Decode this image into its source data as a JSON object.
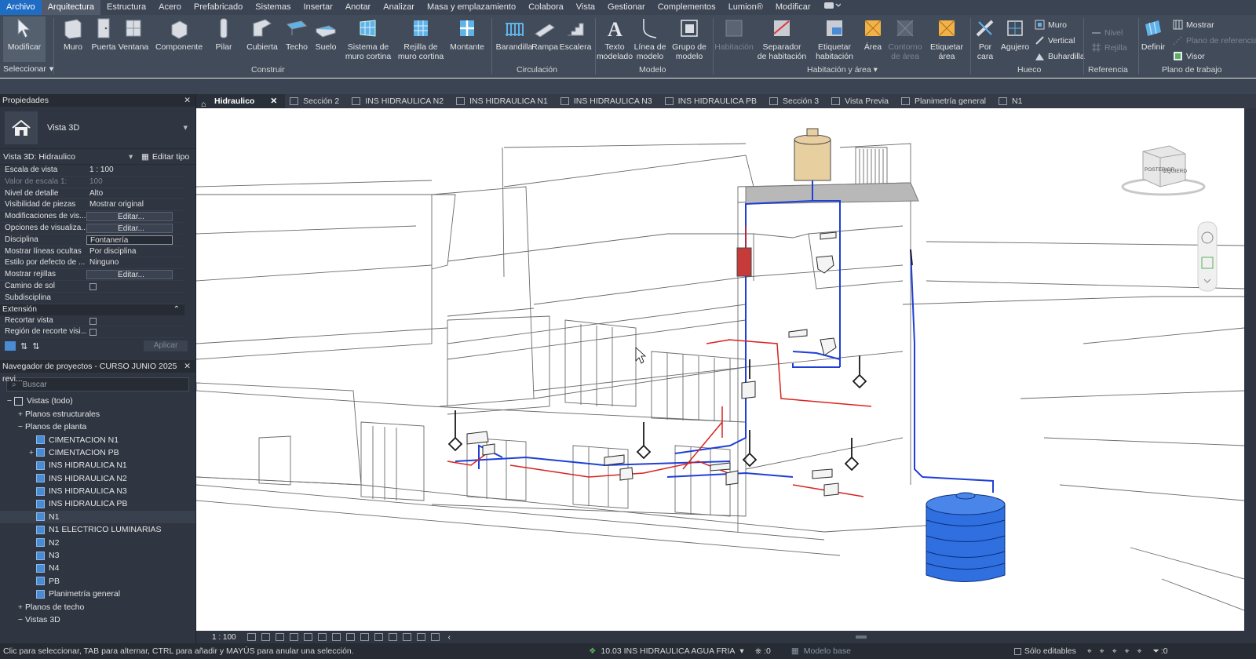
{
  "menu": {
    "items": [
      "Archivo",
      "Arquitectura",
      "Estructura",
      "Acero",
      "Prefabricado",
      "Sistemas",
      "Insertar",
      "Anotar",
      "Analizar",
      "Masa y emplazamiento",
      "Colabora",
      "Vista",
      "Gestionar",
      "Complementos",
      "Lumion®",
      "Modificar"
    ],
    "active": "Arquitectura"
  },
  "ribbon": {
    "modificar": "Modificar",
    "seleccionar": "Seleccionar",
    "construir": {
      "title": "Construir",
      "buttons": [
        "Muro",
        "Puerta",
        "Ventana",
        "Componente",
        "Pilar",
        "Cubierta",
        "Techo",
        "Suelo",
        "Sistema de\nmuro cortina",
        "Rejilla de\nmuro cortina",
        "Montante"
      ]
    },
    "circulacion": {
      "title": "Circulación",
      "buttons": [
        "Barandilla",
        "Rampa",
        "Escalera"
      ]
    },
    "modelo": {
      "title": "Modelo",
      "buttons": [
        "Texto\nmodelado",
        "Línea de\nmodelo",
        "Grupo de\nmodelo"
      ]
    },
    "habitacion": {
      "title": "Habitación y área",
      "buttons": [
        "Habitación",
        "Separador\nde habitación",
        "Etiquetar\nhabitación",
        "Área",
        "Contorno\nde área",
        "Etiquetar\nárea"
      ]
    },
    "hueco": {
      "title": "Hueco",
      "buttons": [
        "Por\ncara",
        "Agujero"
      ],
      "small": [
        "Muro",
        "Vertical",
        "Buhardilla"
      ]
    },
    "referencia": {
      "title": "Referencia",
      "small": [
        "Nivel",
        "Rejilla"
      ]
    },
    "plano": {
      "title": "Plano de trabajo",
      "button": "Definir",
      "small": [
        "Mostrar",
        "Plano de referencia",
        "Visor"
      ]
    }
  },
  "properties": {
    "title": "Propiedades",
    "type_name": "Vista 3D",
    "view_selector": "Vista 3D: Hidraulico",
    "edit_type": "Editar tipo",
    "rows": [
      {
        "name": "Escala de vista",
        "value": "1 : 100",
        "kind": "text"
      },
      {
        "name": "Valor de escala    1:",
        "value": "100",
        "kind": "dim"
      },
      {
        "name": "Nivel de detalle",
        "value": "Alto",
        "kind": "text"
      },
      {
        "name": "Visibilidad de piezas",
        "value": "Mostrar original",
        "kind": "text"
      },
      {
        "name": "Modificaciones de vis...",
        "value": "Editar...",
        "kind": "btn"
      },
      {
        "name": "Opciones de visualiza...",
        "value": "Editar...",
        "kind": "btn"
      },
      {
        "name": "Disciplina",
        "value": "Fontanería",
        "kind": "box"
      },
      {
        "name": "Mostrar líneas ocultas",
        "value": "Por disciplina",
        "kind": "text"
      },
      {
        "name": "Estilo por defecto de ...",
        "value": "Ninguno",
        "kind": "text"
      },
      {
        "name": "Mostrar rejillas",
        "value": "Editar...",
        "kind": "btn"
      },
      {
        "name": "Camino de sol",
        "value": "",
        "kind": "check"
      },
      {
        "name": "Subdisciplina",
        "value": "",
        "kind": "text"
      }
    ],
    "section": "Extensión",
    "rows2": [
      {
        "name": "Recortar vista",
        "value": "",
        "kind": "check"
      },
      {
        "name": "Región de recorte visi...",
        "value": "",
        "kind": "check"
      }
    ],
    "apply": "Aplicar"
  },
  "browser": {
    "title": "Navegador de proyectos - CURSO JUNIO 2025 revi...",
    "search_placeholder": "Buscar",
    "nodes": [
      {
        "label": "Vistas (todo)",
        "level": 0,
        "exp": "−",
        "icon": "views"
      },
      {
        "label": "Planos estructurales",
        "level": 1,
        "exp": "+",
        "icon": ""
      },
      {
        "label": "Planos de planta",
        "level": 1,
        "exp": "−",
        "icon": ""
      },
      {
        "label": "CIMENTACION N1",
        "level": 2,
        "exp": "",
        "icon": "view"
      },
      {
        "label": "CIMENTACION PB",
        "level": 2,
        "exp": "+",
        "icon": "view"
      },
      {
        "label": "INS HIDRAULICA N1",
        "level": 2,
        "exp": "",
        "icon": "view"
      },
      {
        "label": "INS HIDRAULICA N2",
        "level": 2,
        "exp": "",
        "icon": "view"
      },
      {
        "label": "INS HIDRAULICA N3",
        "level": 2,
        "exp": "",
        "icon": "view"
      },
      {
        "label": "INS HIDRAULICA PB",
        "level": 2,
        "exp": "",
        "icon": "view"
      },
      {
        "label": "N1",
        "level": 2,
        "exp": "",
        "icon": "view",
        "selected": true
      },
      {
        "label": "N1 ELECTRICO LUMINARIAS",
        "level": 2,
        "exp": "",
        "icon": "view"
      },
      {
        "label": "N2",
        "level": 2,
        "exp": "",
        "icon": "view"
      },
      {
        "label": "N3",
        "level": 2,
        "exp": "",
        "icon": "view"
      },
      {
        "label": "N4",
        "level": 2,
        "exp": "",
        "icon": "view"
      },
      {
        "label": "PB",
        "level": 2,
        "exp": "",
        "icon": "view"
      },
      {
        "label": "Planimetría general",
        "level": 2,
        "exp": "",
        "icon": "view"
      },
      {
        "label": "Planos de techo",
        "level": 1,
        "exp": "+",
        "icon": ""
      },
      {
        "label": "Vistas 3D",
        "level": 1,
        "exp": "−",
        "icon": ""
      }
    ]
  },
  "tabs": [
    "Hidraulico",
    "Sección 2",
    "INS HIDRAULICA N2",
    "INS HIDRAULICA N1",
    "INS HIDRAULICA N3",
    "INS HIDRAULICA PB",
    "Sección 3",
    "Vista Previa",
    "Planimetría general",
    "N1"
  ],
  "viewcube": {
    "face1": "POSTERIOR",
    "face2": "IZQUIERD"
  },
  "view_control_bar": {
    "scale": "1 : 100"
  },
  "status": {
    "message": "Clic para seleccionar, TAB para alternar, CTRL para añadir y MAYÚS para anular una selección.",
    "workset": "10.03 INS HIDRAULICA AGUA FRIA",
    "count": ":0",
    "model": "Modelo base",
    "editable": "Sólo editables",
    "filter_count": ":0"
  },
  "colors": {
    "cold_water": "#1f3fd6",
    "hot_water": "#d8231f",
    "tank": "#2f6fe0",
    "ui_dark": "#2f3541"
  }
}
